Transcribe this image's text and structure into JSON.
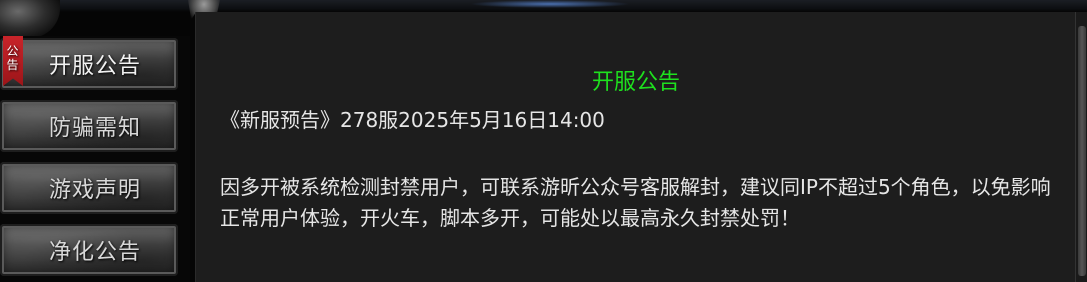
{
  "sidebar": {
    "badge": [
      "公",
      "告"
    ],
    "items": [
      {
        "label": "开服公告"
      },
      {
        "label": "防骗需知"
      },
      {
        "label": "游戏声明"
      },
      {
        "label": "净化公告"
      }
    ]
  },
  "content": {
    "title": "开服公告",
    "date_line": "《新服预告》278服2025年5月16日14:00",
    "body": "因多开被系统检测封禁用户，可联系游昕公众号客服解封，建议同IP不超过5个角色，以免影响正常用户体验，开火车，脚本多开，可能处以最高永久封禁处罚！"
  },
  "colors": {
    "title": "#1ee01e",
    "text": "#e6e6e6",
    "badge": "#c8242a",
    "panel": "#1d1d1d"
  }
}
